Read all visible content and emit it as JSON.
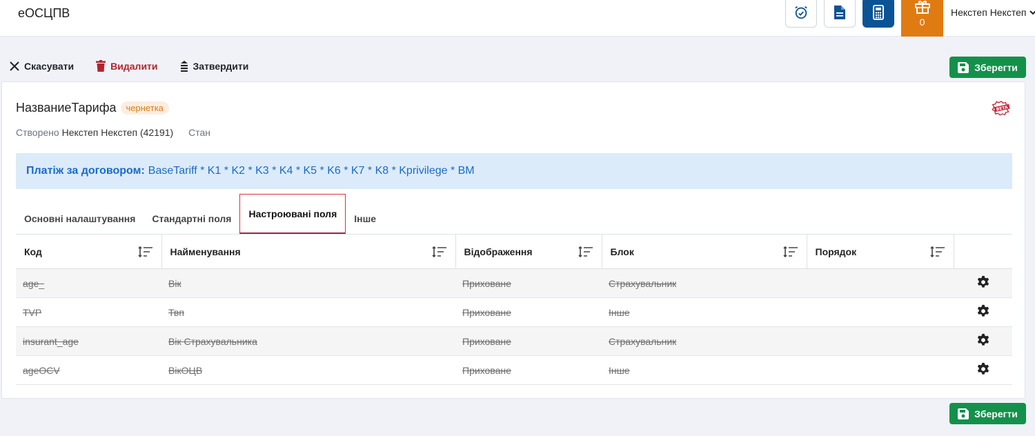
{
  "app": {
    "title": "еОСЦПВ"
  },
  "header": {
    "icons": [
      "alarm-clock-icon",
      "document-icon",
      "calculator-icon"
    ],
    "gift_count": "0",
    "user_name": "Некстеп Некстеп"
  },
  "actions": {
    "cancel": "Скасувати",
    "delete": "Видалити",
    "approve": "Затвердити",
    "save": "Зберегти"
  },
  "tariff": {
    "name": "НазваниеТарифа",
    "status": "чернетка",
    "created_label": "Створено",
    "author": "Некстеп Некстеп (42191)",
    "state_label": "Стан",
    "beta_label": "BETA"
  },
  "formula": {
    "label": "Платіж за договором:",
    "expression": "BaseTariff * K1 * K2 * K3 * K4 * K5 * K6 * K7 * K8 * Kprivilege * BM"
  },
  "tabs": [
    "Основні налаштування",
    "Стандартні поля",
    "Настроювані поля",
    "Інше"
  ],
  "active_tab": "Настроювані поля",
  "table": {
    "columns": [
      "Код",
      "Найменування",
      "Відображення",
      "Блок",
      "Порядок"
    ],
    "rows": [
      {
        "code": "age_",
        "name": "Вік",
        "display": "Приховане",
        "block": "Страхувальник",
        "order": ""
      },
      {
        "code": "TVP",
        "name": "Твп",
        "display": "Приховане",
        "block": "Інше",
        "order": ""
      },
      {
        "code": "insurant_age",
        "name": "Вік Страхувальника",
        "display": "Приховане",
        "block": "Страхувальник",
        "order": ""
      },
      {
        "code": "ageOCV",
        "name": "ВікОЦВ",
        "display": "Приховане",
        "block": "Інше",
        "order": ""
      }
    ]
  },
  "colors": {
    "save": "#13914b",
    "danger": "#b3242c",
    "formula_text": "#1b6ac9",
    "gift": "#e07b12",
    "primary": "#0b5394"
  }
}
